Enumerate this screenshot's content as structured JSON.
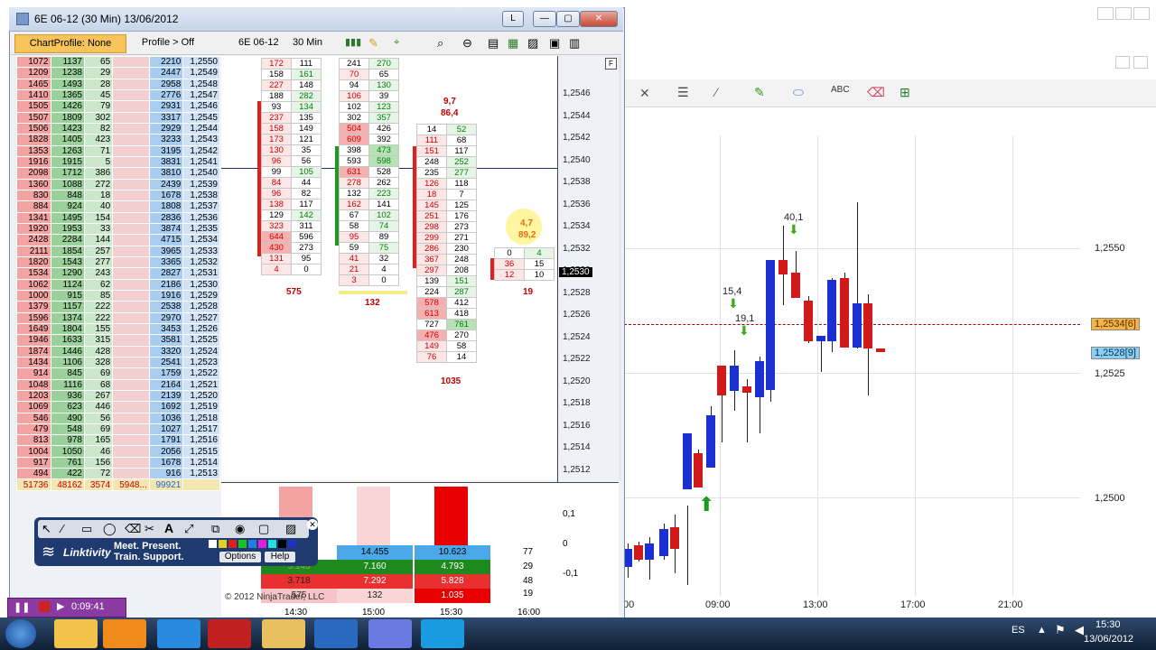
{
  "main_window": {
    "title": "6E 06-12 (30 Min)  13/06/2012",
    "btn_l": "L",
    "btn_min": "—",
    "btn_max": "▢",
    "btn_close": "✕"
  },
  "toolbar": {
    "chart_profile": "ChartProfile: None",
    "profile_off": "Profile > Off",
    "instrument": "6E 06-12",
    "interval": "30 Min",
    "panel_flag": "F"
  },
  "profile_table": {
    "rows": [
      [
        "1072",
        "1137",
        "65",
        "",
        "2210",
        "1,2550"
      ],
      [
        "1209",
        "1238",
        "29",
        "",
        "2447",
        "1,2549"
      ],
      [
        "1465",
        "1493",
        "28",
        "",
        "2958",
        "1,2548"
      ],
      [
        "1410",
        "1365",
        "45",
        "",
        "2776",
        "1,2547"
      ],
      [
        "1505",
        "1426",
        "79",
        "",
        "2931",
        "1,2546"
      ],
      [
        "1507",
        "1809",
        "302",
        "",
        "3317",
        "1,2545"
      ],
      [
        "1506",
        "1423",
        "82",
        "",
        "2929",
        "1,2544"
      ],
      [
        "1828",
        "1405",
        "423",
        "",
        "3233",
        "1,2543"
      ],
      [
        "1353",
        "1263",
        "71",
        "",
        "3195",
        "1,2542"
      ],
      [
        "1916",
        "1915",
        "5",
        "",
        "3831",
        "1,2541"
      ],
      [
        "2098",
        "1712",
        "386",
        "",
        "3810",
        "1,2540"
      ],
      [
        "1360",
        "1088",
        "272",
        "",
        "2439",
        "1,2539"
      ],
      [
        "830",
        "848",
        "18",
        "",
        "1678",
        "1,2538"
      ],
      [
        "884",
        "924",
        "40",
        "",
        "1808",
        "1,2537"
      ],
      [
        "1341",
        "1495",
        "154",
        "",
        "2836",
        "1,2536"
      ],
      [
        "1920",
        "1953",
        "33",
        "",
        "3874",
        "1,2535"
      ],
      [
        "2428",
        "2284",
        "144",
        "",
        "4715",
        "1,2534"
      ],
      [
        "2111",
        "1854",
        "257",
        "",
        "3965",
        "1,2533"
      ],
      [
        "1820",
        "1543",
        "277",
        "",
        "3365",
        "1,2532"
      ],
      [
        "1534",
        "1290",
        "243",
        "",
        "2827",
        "1,2531"
      ],
      [
        "1062",
        "1124",
        "62",
        "",
        "2186",
        "1,2530"
      ],
      [
        "1000",
        "915",
        "85",
        "",
        "1916",
        "1,2529"
      ],
      [
        "1379",
        "1157",
        "222",
        "",
        "2538",
        "1,2528"
      ],
      [
        "1596",
        "1374",
        "222",
        "",
        "2970",
        "1,2527"
      ],
      [
        "1649",
        "1804",
        "155",
        "",
        "3453",
        "1,2526"
      ],
      [
        "1946",
        "1633",
        "315",
        "",
        "3581",
        "1,2525"
      ],
      [
        "1874",
        "1446",
        "428",
        "",
        "3320",
        "1,2524"
      ],
      [
        "1434",
        "1106",
        "328",
        "",
        "2541",
        "1,2523"
      ],
      [
        "914",
        "845",
        "69",
        "",
        "1759",
        "1,2522"
      ],
      [
        "1048",
        "1116",
        "68",
        "",
        "2164",
        "1,2521"
      ],
      [
        "1203",
        "936",
        "267",
        "",
        "2139",
        "1,2520"
      ],
      [
        "1069",
        "623",
        "446",
        "",
        "1692",
        "1,2519"
      ],
      [
        "546",
        "490",
        "56",
        "",
        "1036",
        "1,2518"
      ],
      [
        "479",
        "548",
        "69",
        "",
        "1027",
        "1,2517"
      ],
      [
        "813",
        "978",
        "165",
        "",
        "1791",
        "1,2516"
      ],
      [
        "1004",
        "1050",
        "46",
        "",
        "2056",
        "1,2515"
      ],
      [
        "917",
        "761",
        "156",
        "",
        "1678",
        "1,2514"
      ],
      [
        "494",
        "422",
        "72",
        "",
        "916",
        "1,2513"
      ]
    ],
    "totals": [
      "51736",
      "48162",
      "3574",
      "5948...",
      "99921",
      ""
    ]
  },
  "footprints": [
    {
      "rows": [
        [
          "172",
          "111"
        ],
        [
          "158",
          "161"
        ],
        [
          "227",
          "148"
        ],
        [
          "188",
          "282"
        ],
        [
          "93",
          "134"
        ],
        [
          "237",
          "135"
        ],
        [
          "158",
          "149"
        ],
        [
          "173",
          "121"
        ],
        [
          "130",
          "35"
        ],
        [
          "96",
          "56"
        ],
        [
          "99",
          "105"
        ],
        [
          "84",
          "44"
        ],
        [
          "96",
          "82"
        ],
        [
          "138",
          "117"
        ],
        [
          "129",
          "142"
        ],
        [
          "323",
          "311"
        ],
        [
          "644",
          "596"
        ],
        [
          "430",
          "273"
        ],
        [
          "131",
          "95"
        ],
        [
          "4",
          "0"
        ]
      ],
      "total": "575"
    },
    {
      "rows": [
        [
          "241",
          "270"
        ],
        [
          "70",
          "65"
        ],
        [
          "94",
          "130"
        ],
        [
          "106",
          "39"
        ],
        [
          "102",
          "123"
        ],
        [
          "302",
          "357"
        ],
        [
          "504",
          "426"
        ],
        [
          "609",
          "392"
        ],
        [
          "398",
          "473"
        ],
        [
          "593",
          "598"
        ],
        [
          "631",
          "528"
        ],
        [
          "278",
          "262"
        ],
        [
          "132",
          "223"
        ],
        [
          "162",
          "141"
        ],
        [
          "67",
          "102"
        ],
        [
          "58",
          "74"
        ],
        [
          "95",
          "89"
        ],
        [
          "59",
          "75"
        ],
        [
          "41",
          "32"
        ],
        [
          "21",
          "4"
        ],
        [
          "3",
          "0"
        ]
      ],
      "total": "132"
    },
    {
      "header1": "9,7",
      "header2": "86,4",
      "rows": [
        [
          "14",
          "52"
        ],
        [
          "111",
          "68"
        ],
        [
          "151",
          "117"
        ],
        [
          "248",
          "252"
        ],
        [
          "235",
          "277"
        ],
        [
          "126",
          "118"
        ],
        [
          "18",
          "7"
        ],
        [
          "145",
          "125"
        ],
        [
          "251",
          "176"
        ],
        [
          "298",
          "273"
        ],
        [
          "299",
          "271"
        ],
        [
          "286",
          "230"
        ],
        [
          "367",
          "248"
        ],
        [
          "297",
          "208"
        ],
        [
          "139",
          "151"
        ],
        [
          "224",
          "287"
        ],
        [
          "578",
          "412"
        ],
        [
          "613",
          "418"
        ],
        [
          "727",
          "761"
        ],
        [
          "476",
          "270"
        ],
        [
          "149",
          "58"
        ],
        [
          "76",
          "14"
        ]
      ],
      "total": "1035"
    },
    {
      "header1": "4,7",
      "header2": "89,2",
      "rows": [
        [
          "0",
          "4"
        ],
        [
          "36",
          "15"
        ],
        [
          "12",
          "10"
        ]
      ],
      "total": "19"
    }
  ],
  "price_axis": [
    "1,2546",
    "1,2544",
    "1,2542",
    "1,2540",
    "1,2538",
    "1,2536",
    "1,2534",
    "1,2532",
    "1,2530",
    "1,2528",
    "1,2526",
    "1,2524",
    "1,2522",
    "1,2520",
    "1,2518",
    "1,2516",
    "1,2514",
    "1,2512"
  ],
  "current_price": "1,2530",
  "lower_panel": {
    "axis": [
      "0,1",
      "0",
      "-0,1"
    ],
    "delta_rows": [
      [
        "14.455",
        "10.623",
        "77"
      ],
      [
        "7.160",
        "4.793",
        "29"
      ],
      [
        "7.292",
        "5.828",
        "48"
      ],
      [
        "132",
        "1.035",
        "19"
      ]
    ],
    "col0": [
      "5.143",
      "3.718",
      "575"
    ],
    "copyright": "© 2012 NinjaTrader, LLC",
    "time_axis": [
      "14:30",
      "15:00",
      "15:30",
      "16:00"
    ]
  },
  "bg_chart": {
    "time_axis": [
      "09:00",
      "13:00",
      "17:00",
      "21:00"
    ],
    "edge_time": "00",
    "price_axis": [
      "1,2550",
      "1,2525",
      "1,2500"
    ],
    "tag_red": "1,2534[6]",
    "tag_blue": "1,2528[9]",
    "annotations": [
      "40,1",
      "15,4",
      "19,1"
    ]
  },
  "linktivity": {
    "brand": "Linktivity",
    "slogan1": "Meet. Present.",
    "slogan2": "Train. Support.",
    "options": "Options",
    "help": "Help"
  },
  "recorder": {
    "time": "0:09:41"
  },
  "system_tray": {
    "lang": "ES",
    "time": "15:30",
    "date": "13/06/2012"
  }
}
